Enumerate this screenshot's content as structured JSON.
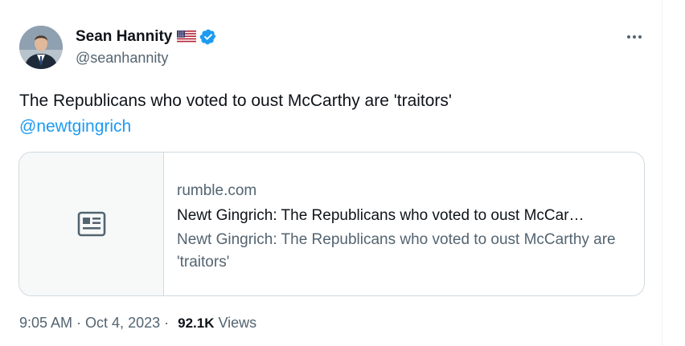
{
  "author": {
    "name": "Sean Hannity",
    "handle": "@seanhannity",
    "avatar_icon": "person-in-suit-avatar",
    "flag_icon": "us-flag-icon",
    "verified_icon": "verified-badge-icon"
  },
  "more_icon": "more-options-icon",
  "tweet": {
    "text": "The Republicans who voted to oust McCarthy are 'traitors'",
    "mention": "@newtgingrich"
  },
  "link_card": {
    "icon": "article-icon",
    "domain": "rumble.com",
    "title": "Newt Gingrich: The Republicans who voted to oust McCar…",
    "description": "Newt Gingrich: The Republicans who voted to oust McCarthy are 'traitors'"
  },
  "meta": {
    "time": "9:05 AM",
    "separator": "·",
    "date": "Oct 4, 2023",
    "separator2": "·",
    "views_count": "92.1K",
    "views_label": "Views"
  },
  "colors": {
    "accent": "#1d9bf0",
    "text_primary": "#0f1419",
    "text_secondary": "#536471",
    "border": "#cfd9de"
  }
}
